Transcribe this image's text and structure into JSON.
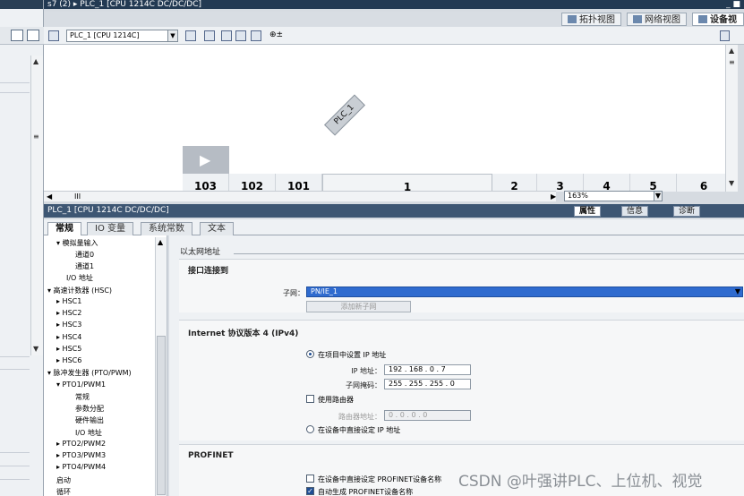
{
  "title_bar": {
    "path": "s7 (2)  ▸  PLC_1 [CPU 1214C DC/DC/DC]",
    "controls": "_ ■"
  },
  "view_tabs": [
    {
      "label": "拓扑视图",
      "icon": "topology-icon"
    },
    {
      "label": "网络视图",
      "icon": "network-icon"
    },
    {
      "label": "设备视图",
      "icon": "device-icon",
      "active": true
    }
  ],
  "toolbar": {
    "device_select": "PLC_1 [CPU 1214C]",
    "zoom_symbol": "⊕±"
  },
  "canvas": {
    "plc_label": "PLC_1",
    "slots": [
      "103",
      "102",
      "101",
      "1",
      "2",
      "3",
      "4",
      "5",
      "6"
    ],
    "zoom": "163%",
    "scroll_marker": "III"
  },
  "properties": {
    "title": "PLC_1 [CPU 1214C DC/DC/DC]",
    "tabs": [
      "属性",
      "信息",
      "诊断"
    ],
    "subtabs": [
      "常规",
      "IO 变量",
      "系统常数",
      "文本"
    ]
  },
  "tree": [
    {
      "label": "▾ 模拟量输入",
      "indent": 1
    },
    {
      "label": "通道0",
      "indent": 3
    },
    {
      "label": "通道1",
      "indent": 3
    },
    {
      "label": "I/O 地址",
      "indent": 2
    },
    {
      "label": "▾ 高速计数器 (HSC)",
      "indent": 0
    },
    {
      "label": "▸ HSC1",
      "indent": 1
    },
    {
      "label": "▸ HSC2",
      "indent": 1
    },
    {
      "label": "▸ HSC3",
      "indent": 1
    },
    {
      "label": "▸ HSC4",
      "indent": 1
    },
    {
      "label": "▸ HSC5",
      "indent": 1
    },
    {
      "label": "▸ HSC6",
      "indent": 1
    },
    {
      "label": "▾ 脉冲发生器 (PTO/PWM)",
      "indent": 0
    },
    {
      "label": "▾ PTO1/PWM1",
      "indent": 1
    },
    {
      "label": "常规",
      "indent": 3
    },
    {
      "label": "参数分配",
      "indent": 3
    },
    {
      "label": "硬件输出",
      "indent": 3
    },
    {
      "label": "I/O 地址",
      "indent": 3
    },
    {
      "label": "▸ PTO2/PWM2",
      "indent": 1
    },
    {
      "label": "▸ PTO3/PWM3",
      "indent": 1
    },
    {
      "label": "▸ PTO4/PWM4",
      "indent": 1
    },
    {
      "label": "启动",
      "indent": 0
    },
    {
      "label": "循环",
      "indent": 0
    }
  ],
  "content": {
    "heading": "以太网地址",
    "interface": {
      "title": "接口连接到",
      "subnet_label": "子网：",
      "subnet_value": "PN/IE_1",
      "add_subnet": "添加新子网"
    },
    "ipv4": {
      "title": "Internet 协议版本 4 (IPv4)",
      "opt_project": "在项目中设置 IP 地址",
      "ip_label": "IP 地址：",
      "ip": [
        "192",
        "168",
        "0",
        "7"
      ],
      "mask_label": "子网掩码：",
      "mask": [
        "255",
        "255",
        "255",
        "0"
      ],
      "use_router": "使用路由器",
      "router_label": "路由器地址：",
      "router": [
        "0",
        "0",
        "0",
        "0"
      ],
      "opt_direct": "在设备中直接设定 IP 地址"
    },
    "profinet": {
      "title": "PROFINET",
      "opt_direct_name": "在设备中直接设定 PROFINET设备名称",
      "opt_auto_name": "自动生成 PROFINET设备名称"
    }
  },
  "watermark": "CSDN @叶强讲PLC、上位机、视觉"
}
